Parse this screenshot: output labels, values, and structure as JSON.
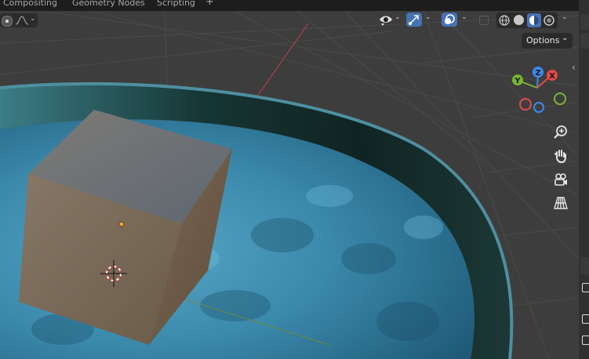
{
  "workspace_tabs": [
    {
      "label": "Compositing"
    },
    {
      "label": "Geometry Nodes"
    },
    {
      "label": "Scripting"
    },
    {
      "label": "+"
    }
  ],
  "viewport_header": {
    "options_label": "Options",
    "options_chevron": "⌄"
  },
  "gizmo": {
    "axis_z": "Z",
    "axis_y": "Y",
    "axis_x": "X"
  },
  "navigation_tools": [
    "zoom-icon",
    "hand-pan-icon",
    "camera-view-icon",
    "grid-perspective-icon"
  ],
  "colors": {
    "background": "#3d3d3d",
    "header_bg": "#1d1d1d",
    "active_button": "#4772b3",
    "axis_x": "#e44a4a",
    "axis_y": "#7ab536",
    "axis_z": "#3b8af0",
    "water": "#3e8eb0",
    "cube": "#7a6a55"
  }
}
